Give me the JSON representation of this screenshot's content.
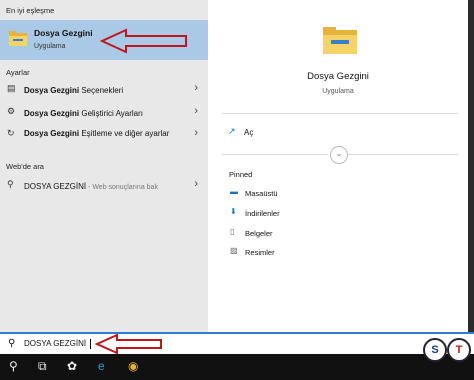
{
  "left_panel": {
    "best_match_title": "En iyi eşleşme",
    "best_match": {
      "title": "Dosya Gezgini",
      "subtitle": "Uygulama"
    },
    "settings_title": "Ayarlar",
    "settings_items": [
      {
        "bold": "Dosya Gezgini",
        "rest": " Seçenekleri"
      },
      {
        "bold": "Dosya Gezgini",
        "rest": " Geliştirici Ayarları"
      },
      {
        "bold": "Dosya Gezgini",
        "rest": " Eşitleme ve diğer ayarlar"
      }
    ],
    "web_title": "Web'de ara",
    "web_item": {
      "query": "DOSYA GEZGİNİ",
      "hint": " - Web sonuçlarına bak"
    }
  },
  "right_panel": {
    "app_title": "Dosya Gezgini",
    "app_subtitle": "Uygulama",
    "open_label": "Aç",
    "pinned_title": "Pinned",
    "pinned_items": [
      "Masaüstü",
      "İndirilenler",
      "Belgeler",
      "Resimler"
    ]
  },
  "search": {
    "value": "DOSYA GEZGİNİ"
  },
  "colors": {
    "accent": "#2d7dd2",
    "selection": "#a9c9e6",
    "annotation_arrow": "#c0151b"
  }
}
